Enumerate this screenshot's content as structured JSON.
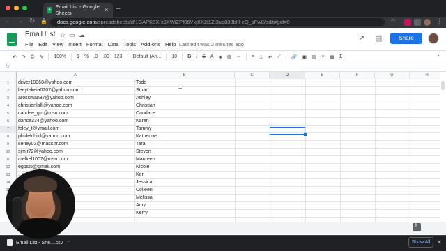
{
  "browser": {
    "tab_title": "Email List - Google Sheets",
    "url_host": "docs.google.com",
    "url_path": "/spreadsheets/d/1GAPK9X-x9XWiZPf06VxjXX2i1Zt3uq833bH-eQ_sFw8/edit#gid=0"
  },
  "sheet": {
    "title": "Email List",
    "menus": [
      "File",
      "Edit",
      "View",
      "Insert",
      "Format",
      "Data",
      "Tools",
      "Add-ons",
      "Help"
    ],
    "last_edit": "Last edit was 2 minutes ago",
    "share_label": "Share"
  },
  "toolbar": {
    "zoom": "100%",
    "currency": "$",
    "percent": "%",
    "dec_less": ".0",
    "dec_more": ".00",
    "more_formats": "123",
    "font": "Default (Ari...",
    "font_size": "10",
    "bold": "B",
    "italic": "I",
    "strike": "S",
    "text_color": "A"
  },
  "formula_bar": {
    "label": "fx"
  },
  "columns": [
    "A",
    "B",
    "C",
    "D",
    "E",
    "F",
    "G",
    "H"
  ],
  "selected_column": "D",
  "rows": [
    {
      "n": "1",
      "a": "driver10068@yahoo.com",
      "b": "Todd"
    },
    {
      "n": "2",
      "a": "leeytekeia0207@yahoo.com",
      "b": "Stuart"
    },
    {
      "n": "3",
      "a": "arossman37@yahoo.com",
      "b": "Ashley"
    },
    {
      "n": "4",
      "a": "christianlalli@yahoo.com",
      "b": "Christian"
    },
    {
      "n": "5",
      "a": "candee_girl@msn.com",
      "b": "Candace"
    },
    {
      "n": "6",
      "a": "dance334@yahoo.com",
      "b": "Karen"
    },
    {
      "n": "7",
      "a": "foley_t@ymail.com",
      "b": "Tammy"
    },
    {
      "n": "8",
      "a": "phidelchild@yahoo.com",
      "b": "Katherine"
    },
    {
      "n": "9",
      "a": "seney03@mass.rr.com",
      "b": "Tara"
    },
    {
      "n": "10",
      "a": "sjmjr72@yahoo.com",
      "b": "Steven"
    },
    {
      "n": "11",
      "a": "melkel1007@msn.com",
      "b": "Maureen"
    },
    {
      "n": "12",
      "a": "egpst5@gmail.com",
      "b": "Nicole"
    },
    {
      "n": "13",
      "a": "...oo.com",
      "b": "Keri"
    },
    {
      "n": "14",
      "a": "",
      "b": "Jessica"
    },
    {
      "n": "15",
      "a": "",
      "b": "Colleen"
    },
    {
      "n": "16",
      "a": "...com",
      "b": "Melissa"
    },
    {
      "n": "17",
      "a": "",
      "b": "Amy"
    },
    {
      "n": "18",
      "a": "",
      "b": "Kerry"
    }
  ],
  "downloads": {
    "file": "Email List - She....csv",
    "show_all": "Show All"
  }
}
